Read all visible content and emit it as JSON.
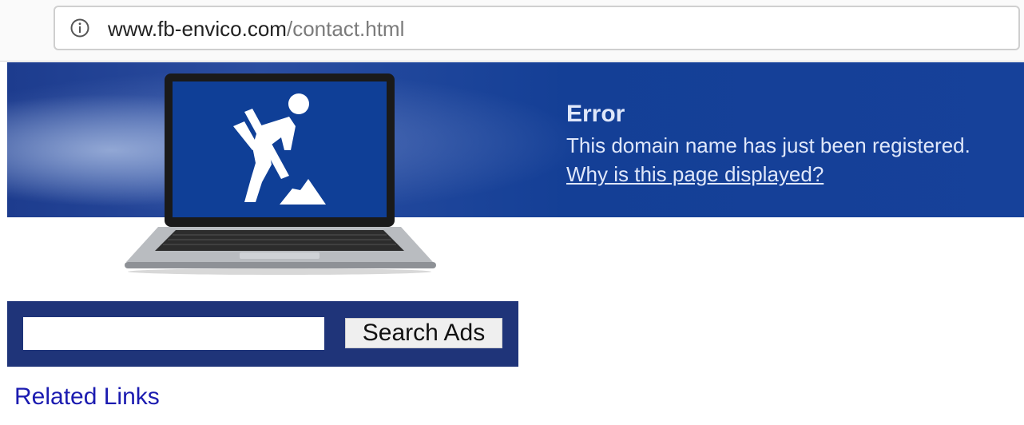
{
  "browser": {
    "url_domain": "www.fb-envico.com",
    "url_path": "/contact.html",
    "info_icon": "info-circle-icon"
  },
  "banner": {
    "error_title": "Error",
    "error_message": "This domain name has just been registered.",
    "why_link": "Why is this page displayed?",
    "illustration": "laptop-construction-worker-icon"
  },
  "search": {
    "input_value": "",
    "button_label": "Search Ads"
  },
  "related": {
    "title": "Related Links"
  },
  "colors": {
    "banner_blue": "#16419a",
    "search_panel": "#1f3479",
    "link_blue": "#1b1bb0",
    "banner_text": "#dfe7fa"
  }
}
